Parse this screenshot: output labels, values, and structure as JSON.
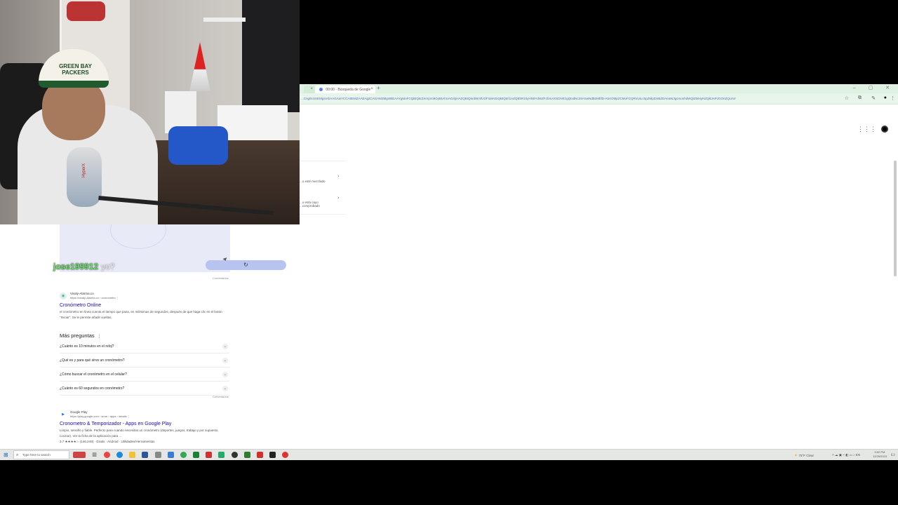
{
  "browser": {
    "tab_left_close": "×",
    "tab_active_title": "00:00 - Búsqueda de Google",
    "tab_close": "×",
    "new_tab": "+",
    "window_controls": "–  ▢  ✕",
    "url": "...Cng0cUAEMgsIAhAAGAwYCCA8EMZAAEAg2CAGAM3MgsIBEAAYgMoFCQBIQ5rZmVyVo9OyBtAhUAGIQHAZQBIQ5rdWmfUOFsMAGIQBIQ5rGAZQBhR10yHN9YdWZFzbmAXSDNlCIgQtvdNc29ASwNdB2MbfD-A5AOMpZCMoFCQRIASLc0pZMpZmBZDAeaWJgcmonhdWQiZMHyHZQBJAPJGOnZQUAmEQzREIpFAKDD-sdwIghAIIC5wYk4j8A8VlIEdc8-pfnhgXvBX3d4wMpZoK1zhbFpZ8AbD2cmVuYXbvQBBIdWWsrA5ENAaGOHDo5r2A4K-Bm70OUFhDbIk5YNPv1d2o5C8M2V7YS5NkJgN6kG1AqPdRaQpCnOhbvEN3dt4Sf5vxbJGNqZVUtYtkbWJjL7Kv8dAyPqM1fULA6JsqOcXvSqCQGOtGDb8uwvK4GWVMN5KH9NVX8aW6Qd8P3UN6nAs8Nu-OH5ENtz3LW2UjMYjvQ6b0jq1CQHJB55mNLFJzxKnZBQb71kUX9jUc5bCwPH9fFOHLDFPHAA4c8mA2&sca_esv=...&hl=es-419&oq=cron",
    "side_items": [
      {
        "label": "...o esté mezclado",
        "chev": "›"
      },
      {
        "label": "...o está cayo ...comprobado",
        "chev": "›"
      }
    ],
    "apps_icon": "⋮⋮⋮"
  },
  "results": {
    "reset_icon": "↻",
    "chat_user": "jose199912",
    "chat_text": "yo?",
    "comments1": "Comentarios",
    "r1": {
      "fav": "◉",
      "site": "Vivaly-Alarma.co",
      "url": "https://vivaly-alarma.co › cronometro  ⋮",
      "title": "Cronómetro Online",
      "snippet": "el cronómetro en línea cuenta el tiempo que pasa, en milésimas de segundos, después de que haga clic en el botón \"Iniciar\". Se le permite añadir vueltas."
    },
    "paa_heading": "Más preguntas",
    "paa_dots": "⋮",
    "paa": [
      "¿Cuánto es 10 minutos en el reloj?",
      "¿Qué es y para qué sirve un cronómetro?",
      "¿Cómo buscar el cronómetro en el celular?",
      "¿Cuánto es 60 segundos en cronómetro?"
    ],
    "paa_chev": "⌄",
    "comments2": "Comentarios",
    "r2": {
      "fav": "▶",
      "site": "Google Play",
      "url": "https://play.google.com › store › apps › details  ⋮",
      "title": "Cronometro & Temporizador - Apps en Google Play",
      "snippet": "Limpio, sencillo y fiable. Perfecto para cuando necesitas un cronómetro (deportes, juegos, trabajo y por supuesto, cocinar). Ver la ficha de la aplicación para ...",
      "rating": "3.7 ★★★★☆ (146,249) · Gratis · Android · Utilidades/Herramientas"
    }
  },
  "webcam": {
    "cap_text": "GREEN BAY PACKERS",
    "mic_brand": "HyperX"
  },
  "taskbar": {
    "start": "⊞",
    "search_placeholder": "Type here to search",
    "search_glyph": "⌕",
    "weather": "75°F  Clear",
    "tray_icons": "˄  ☁  ▣  ⌁  ◧  ▭  ♪  EN",
    "time": "9:52 PM",
    "date": "12/26/2023"
  }
}
